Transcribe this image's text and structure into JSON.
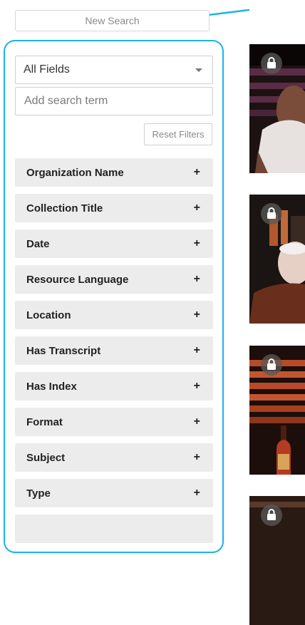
{
  "search": {
    "new_search_label": "New Search",
    "field_select_value": "All Fields",
    "term_placeholder": "Add search term",
    "reset_label": "Reset Filters"
  },
  "facets": [
    {
      "label": "Organization Name",
      "icon": "+"
    },
    {
      "label": "Collection Title",
      "icon": "+"
    },
    {
      "label": "Date",
      "icon": "+"
    },
    {
      "label": "Resource Language",
      "icon": "+"
    },
    {
      "label": "Location",
      "icon": "+"
    },
    {
      "label": "Has Transcript",
      "icon": "+"
    },
    {
      "label": "Has Index",
      "icon": "+"
    },
    {
      "label": "Format",
      "icon": "+"
    },
    {
      "label": "Subject",
      "icon": "+"
    },
    {
      "label": "Type",
      "icon": "+"
    }
  ],
  "results": [
    {
      "icon": "lock-icon"
    },
    {
      "icon": "lock-icon"
    },
    {
      "icon": "lock-icon"
    },
    {
      "icon": "lock-icon"
    }
  ],
  "colors": {
    "annotation": "#1ab4e8",
    "facet_background": "#ececec"
  }
}
